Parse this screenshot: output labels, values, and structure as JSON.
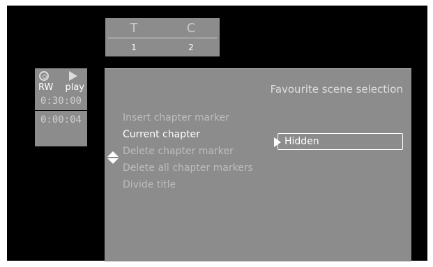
{
  "title_counter": {
    "title_label": "T",
    "chapter_label": "C",
    "title_value": "1",
    "chapter_value": "2"
  },
  "status": {
    "disc_label": "RW",
    "play_label": "play",
    "total_time": "0:30:00",
    "elapsed_time": "0:00:04"
  },
  "menu": {
    "title": "Favourite scene selection",
    "items": [
      {
        "label": "Insert chapter marker"
      },
      {
        "label": "Current chapter"
      },
      {
        "label": "Delete chapter marker"
      },
      {
        "label": "Delete all chapter markers"
      },
      {
        "label": "Divide title"
      }
    ],
    "selected_index": 1,
    "current_chapter_value": "Hidden"
  },
  "colors": {
    "screen_bg": "#000000",
    "panel_bg": "#8c8c8c",
    "highlight_text": "#ffffff",
    "dim_text": "#bdbdbd"
  },
  "icons": [
    "disc-icon",
    "play-icon",
    "up-down-arrows-icon",
    "right-arrow-icon"
  ]
}
